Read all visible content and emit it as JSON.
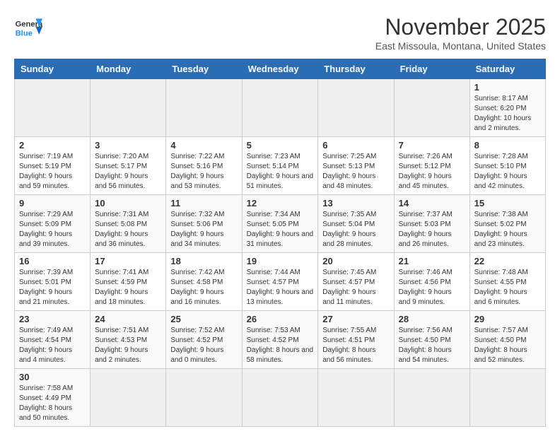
{
  "logo": {
    "line1": "General",
    "line2": "Blue"
  },
  "title": "November 2025",
  "location": "East Missoula, Montana, United States",
  "weekdays": [
    "Sunday",
    "Monday",
    "Tuesday",
    "Wednesday",
    "Thursday",
    "Friday",
    "Saturday"
  ],
  "weeks": [
    [
      {
        "day": "",
        "info": ""
      },
      {
        "day": "",
        "info": ""
      },
      {
        "day": "",
        "info": ""
      },
      {
        "day": "",
        "info": ""
      },
      {
        "day": "",
        "info": ""
      },
      {
        "day": "",
        "info": ""
      },
      {
        "day": "1",
        "info": "Sunrise: 8:17 AM\nSunset: 6:20 PM\nDaylight: 10 hours and 2 minutes."
      }
    ],
    [
      {
        "day": "2",
        "info": "Sunrise: 7:19 AM\nSunset: 5:19 PM\nDaylight: 9 hours and 59 minutes."
      },
      {
        "day": "3",
        "info": "Sunrise: 7:20 AM\nSunset: 5:17 PM\nDaylight: 9 hours and 56 minutes."
      },
      {
        "day": "4",
        "info": "Sunrise: 7:22 AM\nSunset: 5:16 PM\nDaylight: 9 hours and 53 minutes."
      },
      {
        "day": "5",
        "info": "Sunrise: 7:23 AM\nSunset: 5:14 PM\nDaylight: 9 hours and 51 minutes."
      },
      {
        "day": "6",
        "info": "Sunrise: 7:25 AM\nSunset: 5:13 PM\nDaylight: 9 hours and 48 minutes."
      },
      {
        "day": "7",
        "info": "Sunrise: 7:26 AM\nSunset: 5:12 PM\nDaylight: 9 hours and 45 minutes."
      },
      {
        "day": "8",
        "info": "Sunrise: 7:28 AM\nSunset: 5:10 PM\nDaylight: 9 hours and 42 minutes."
      }
    ],
    [
      {
        "day": "9",
        "info": "Sunrise: 7:29 AM\nSunset: 5:09 PM\nDaylight: 9 hours and 39 minutes."
      },
      {
        "day": "10",
        "info": "Sunrise: 7:31 AM\nSunset: 5:08 PM\nDaylight: 9 hours and 36 minutes."
      },
      {
        "day": "11",
        "info": "Sunrise: 7:32 AM\nSunset: 5:06 PM\nDaylight: 9 hours and 34 minutes."
      },
      {
        "day": "12",
        "info": "Sunrise: 7:34 AM\nSunset: 5:05 PM\nDaylight: 9 hours and 31 minutes."
      },
      {
        "day": "13",
        "info": "Sunrise: 7:35 AM\nSunset: 5:04 PM\nDaylight: 9 hours and 28 minutes."
      },
      {
        "day": "14",
        "info": "Sunrise: 7:37 AM\nSunset: 5:03 PM\nDaylight: 9 hours and 26 minutes."
      },
      {
        "day": "15",
        "info": "Sunrise: 7:38 AM\nSunset: 5:02 PM\nDaylight: 9 hours and 23 minutes."
      }
    ],
    [
      {
        "day": "16",
        "info": "Sunrise: 7:39 AM\nSunset: 5:01 PM\nDaylight: 9 hours and 21 minutes."
      },
      {
        "day": "17",
        "info": "Sunrise: 7:41 AM\nSunset: 4:59 PM\nDaylight: 9 hours and 18 minutes."
      },
      {
        "day": "18",
        "info": "Sunrise: 7:42 AM\nSunset: 4:58 PM\nDaylight: 9 hours and 16 minutes."
      },
      {
        "day": "19",
        "info": "Sunrise: 7:44 AM\nSunset: 4:57 PM\nDaylight: 9 hours and 13 minutes."
      },
      {
        "day": "20",
        "info": "Sunrise: 7:45 AM\nSunset: 4:57 PM\nDaylight: 9 hours and 11 minutes."
      },
      {
        "day": "21",
        "info": "Sunrise: 7:46 AM\nSunset: 4:56 PM\nDaylight: 9 hours and 9 minutes."
      },
      {
        "day": "22",
        "info": "Sunrise: 7:48 AM\nSunset: 4:55 PM\nDaylight: 9 hours and 6 minutes."
      }
    ],
    [
      {
        "day": "23",
        "info": "Sunrise: 7:49 AM\nSunset: 4:54 PM\nDaylight: 9 hours and 4 minutes."
      },
      {
        "day": "24",
        "info": "Sunrise: 7:51 AM\nSunset: 4:53 PM\nDaylight: 9 hours and 2 minutes."
      },
      {
        "day": "25",
        "info": "Sunrise: 7:52 AM\nSunset: 4:52 PM\nDaylight: 9 hours and 0 minutes."
      },
      {
        "day": "26",
        "info": "Sunrise: 7:53 AM\nSunset: 4:52 PM\nDaylight: 8 hours and 58 minutes."
      },
      {
        "day": "27",
        "info": "Sunrise: 7:55 AM\nSunset: 4:51 PM\nDaylight: 8 hours and 56 minutes."
      },
      {
        "day": "28",
        "info": "Sunrise: 7:56 AM\nSunset: 4:50 PM\nDaylight: 8 hours and 54 minutes."
      },
      {
        "day": "29",
        "info": "Sunrise: 7:57 AM\nSunset: 4:50 PM\nDaylight: 8 hours and 52 minutes."
      }
    ],
    [
      {
        "day": "30",
        "info": "Sunrise: 7:58 AM\nSunset: 4:49 PM\nDaylight: 8 hours and 50 minutes."
      },
      {
        "day": "",
        "info": ""
      },
      {
        "day": "",
        "info": ""
      },
      {
        "day": "",
        "info": ""
      },
      {
        "day": "",
        "info": ""
      },
      {
        "day": "",
        "info": ""
      },
      {
        "day": "",
        "info": ""
      }
    ]
  ]
}
